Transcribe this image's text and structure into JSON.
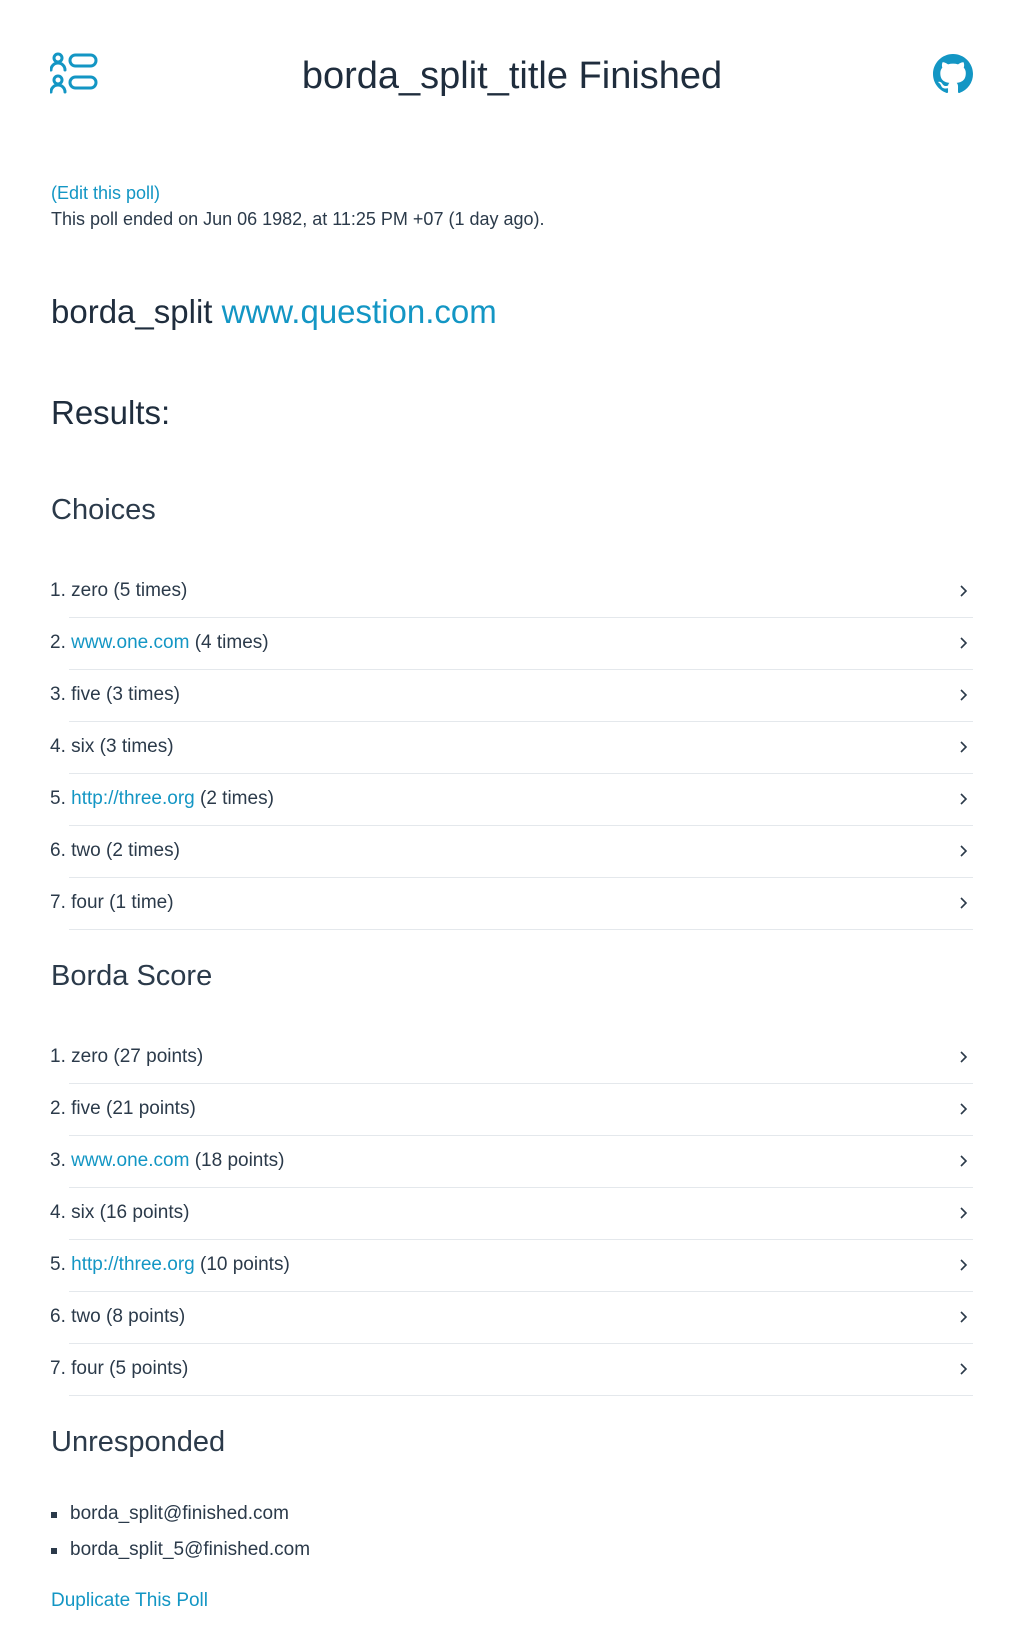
{
  "header": {
    "title": "borda_split_title Finished",
    "logo_icon": "poll-list-icon",
    "github_icon": "github-icon"
  },
  "poll": {
    "edit_label": "(Edit this poll)",
    "ended_text": "This poll ended on Jun 06 1982, at 11:25 PM +07 (1 day ago).",
    "question_text": "borda_split",
    "question_link": "www.question.com"
  },
  "results": {
    "heading": "Results:",
    "choices": {
      "heading": "Choices",
      "items": [
        {
          "rank": "1.",
          "name": "zero",
          "is_link": false,
          "count": "(5 times)"
        },
        {
          "rank": "2.",
          "name": "www.one.com",
          "is_link": true,
          "count": "(4 times)"
        },
        {
          "rank": "3.",
          "name": "five",
          "is_link": false,
          "count": "(3 times)"
        },
        {
          "rank": "4.",
          "name": "six",
          "is_link": false,
          "count": "(3 times)"
        },
        {
          "rank": "5.",
          "name": "http://three.org",
          "is_link": true,
          "count": "(2 times)"
        },
        {
          "rank": "6.",
          "name": "two",
          "is_link": false,
          "count": "(2 times)"
        },
        {
          "rank": "7.",
          "name": "four",
          "is_link": false,
          "count": "(1 time)"
        }
      ]
    },
    "borda": {
      "heading": "Borda Score",
      "items": [
        {
          "rank": "1.",
          "name": "zero",
          "is_link": false,
          "count": "(27 points)"
        },
        {
          "rank": "2.",
          "name": "five",
          "is_link": false,
          "count": "(21 points)"
        },
        {
          "rank": "3.",
          "name": "www.one.com",
          "is_link": true,
          "count": "(18 points)"
        },
        {
          "rank": "4.",
          "name": "six",
          "is_link": false,
          "count": "(16 points)"
        },
        {
          "rank": "5.",
          "name": "http://three.org",
          "is_link": true,
          "count": "(10 points)"
        },
        {
          "rank": "6.",
          "name": "two",
          "is_link": false,
          "count": "(8 points)"
        },
        {
          "rank": "7.",
          "name": "four",
          "is_link": false,
          "count": "(5 points)"
        }
      ]
    },
    "unresponded": {
      "heading": "Unresponded",
      "emails": [
        "borda_split@finished.com",
        "borda_split_5@finished.com"
      ]
    }
  },
  "footer": {
    "duplicate_label": "Duplicate This Poll"
  },
  "colors": {
    "accent": "#1396c4",
    "text": "#1f2d3d",
    "divider": "#e4e8ec"
  }
}
